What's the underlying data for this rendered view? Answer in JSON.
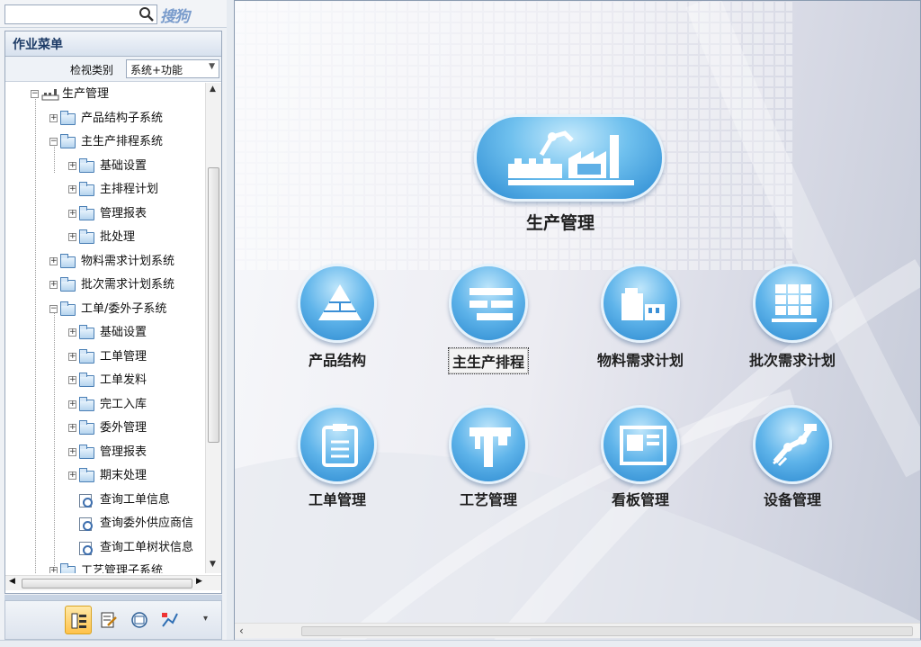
{
  "search": {
    "placeholder": "",
    "brand": "搜狗"
  },
  "menu": {
    "title": "作业菜单",
    "filter_label": "检视类别",
    "filter_value": "系统+功能"
  },
  "tree": [
    {
      "label": "生产管理",
      "type": "root"
    },
    {
      "label": "产品结构子系统",
      "type": "folder"
    },
    {
      "label": "主生产排程系统",
      "type": "folder"
    },
    {
      "label": "基础设置",
      "type": "folder"
    },
    {
      "label": "主排程计划",
      "type": "folder"
    },
    {
      "label": "管理报表",
      "type": "folder"
    },
    {
      "label": "批处理",
      "type": "folder"
    },
    {
      "label": "物料需求计划系统",
      "type": "folder"
    },
    {
      "label": "批次需求计划系统",
      "type": "folder"
    },
    {
      "label": "工单/委外子系统",
      "type": "folder"
    },
    {
      "label": "基础设置",
      "type": "folder"
    },
    {
      "label": "工单管理",
      "type": "folder"
    },
    {
      "label": "工单发料",
      "type": "folder"
    },
    {
      "label": "完工入库",
      "type": "folder"
    },
    {
      "label": "委外管理",
      "type": "folder"
    },
    {
      "label": "管理报表",
      "type": "folder"
    },
    {
      "label": "期末处理",
      "type": "folder"
    },
    {
      "label": "查询工单信息",
      "type": "doc"
    },
    {
      "label": "查询委外供应商信",
      "type": "doc"
    },
    {
      "label": "查询工单树状信息",
      "type": "doc"
    },
    {
      "label": "工艺管理子系统",
      "type": "folder"
    }
  ],
  "main": {
    "hero_label": "生产管理",
    "features": [
      {
        "label": "产品结构",
        "icon": "pyramid-icon"
      },
      {
        "label": "主生产排程",
        "icon": "schedule-icon"
      },
      {
        "label": "物料需求计划",
        "icon": "material-icon"
      },
      {
        "label": "批次需求计划",
        "icon": "grid-icon"
      },
      {
        "label": "工单管理",
        "icon": "clipboard-icon"
      },
      {
        "label": "工艺管理",
        "icon": "caliper-icon"
      },
      {
        "label": "看板管理",
        "icon": "board-icon"
      },
      {
        "label": "设备管理",
        "icon": "robot-arm-icon"
      }
    ]
  },
  "colors": {
    "accent": "#2a88cf",
    "header_text": "#1d3b66"
  }
}
